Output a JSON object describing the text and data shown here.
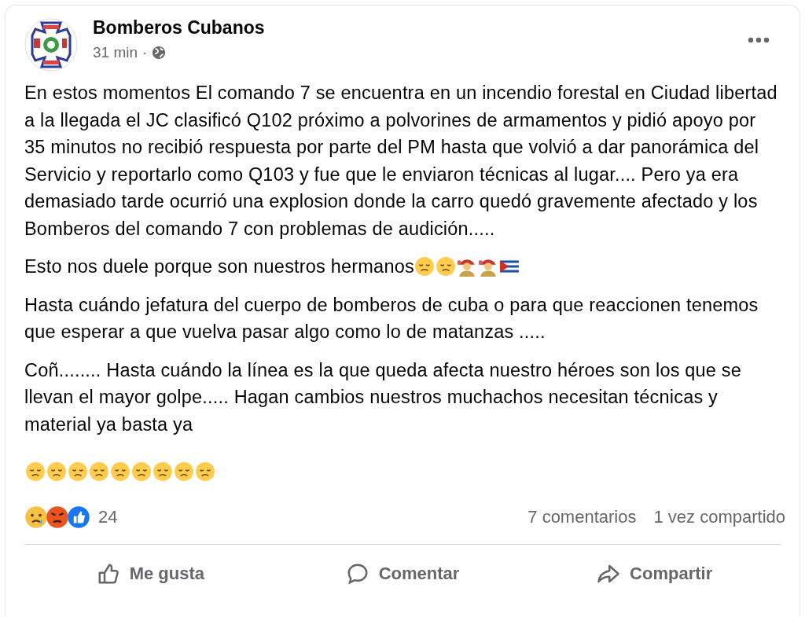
{
  "post": {
    "author": "Bomberos Cubanos",
    "time": "31 min",
    "separator": "·",
    "paragraphs": [
      {
        "text": "En estos momentos El comando 7 se encuentra en un incendio forestal en Ciudad libertad a la llegada el JC clasificó Q102 próximo a polvorines de armamentos y pidió apoyo por 35 minutos no recibió respuesta por parte del PM hasta que volvió a dar panorámica del Servicio y reportarlo como Q103 y fue que le enviaron técnicas al lugar.... Pero ya era demasiado tarde ocurrió una explosion donde la carro quedó gravemente afectado y los Bomberos del comando 7 con problemas de audición....."
      },
      {
        "text": "Esto nos duele porque son nuestros hermanos",
        "icons": [
          {
            "kind": "pensive"
          },
          {
            "kind": "pensive"
          },
          {
            "kind": "firefighter"
          },
          {
            "kind": "firefighter"
          },
          {
            "kind": "flag"
          }
        ]
      },
      {
        "text": "Hasta cuándo jefatura del cuerpo de bomberos de cuba o para que reaccionen tenemos que esperar a que vuelva pasar algo como lo de matanzas ....."
      },
      {
        "text": "Coñ........ Hasta cuándo la línea es la que queda afecta nuestro héroes son los que se llevan el mayor golpe..... Hagan cambios nuestros muchachos necesitan técnicas y material ya basta ya"
      },
      {
        "icons": [
          {
            "kind": "pensive"
          },
          {
            "kind": "pensive"
          },
          {
            "kind": "pensive"
          },
          {
            "kind": "pensive"
          },
          {
            "kind": "pensive"
          },
          {
            "kind": "pensive"
          },
          {
            "kind": "pensive"
          },
          {
            "kind": "pensive"
          },
          {
            "kind": "pensive"
          }
        ]
      }
    ],
    "reactions": [
      {
        "kind": "sad"
      },
      {
        "kind": "angry"
      },
      {
        "kind": "like"
      }
    ],
    "reaction_count": "24",
    "comments": "7 comentarios",
    "shares": "1 vez compartido",
    "actions": [
      {
        "kind": "like",
        "label": "Me gusta"
      },
      {
        "kind": "comment",
        "label": "Comentar"
      },
      {
        "kind": "share",
        "label": "Compartir"
      }
    ]
  }
}
